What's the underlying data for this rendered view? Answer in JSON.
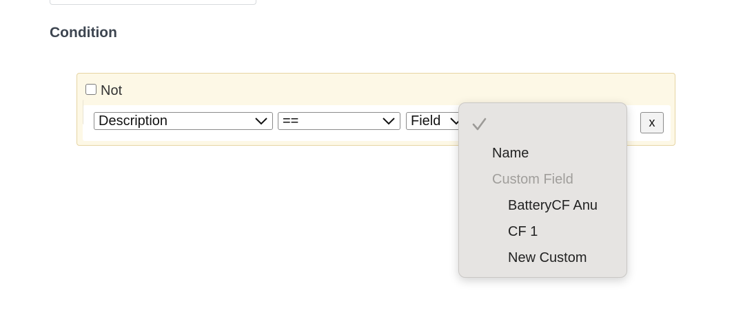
{
  "section": {
    "title": "Condition"
  },
  "condition": {
    "not_label": "Not",
    "not_checked": false,
    "field_select": {
      "value": "Description"
    },
    "operator_select": {
      "value": "=="
    },
    "compare_select": {
      "value": "Field"
    },
    "remove_label": "x"
  },
  "dropdown": {
    "selected_icon": "checkmark-icon",
    "items": [
      {
        "label": "Name",
        "enabled": true
      },
      {
        "label": "Custom Field",
        "enabled": false,
        "is_group": true
      },
      {
        "label": "BatteryCF Anu",
        "enabled": true
      },
      {
        "label": "CF 1",
        "enabled": true
      },
      {
        "label": "New Custom",
        "enabled": true
      }
    ]
  },
  "colors": {
    "condition_bg": "#fdf8e6",
    "condition_border": "#e6d4a2",
    "title_color": "#3d4550",
    "menu_bg": "#e6e4e2",
    "disabled_text": "#a09e9b"
  }
}
